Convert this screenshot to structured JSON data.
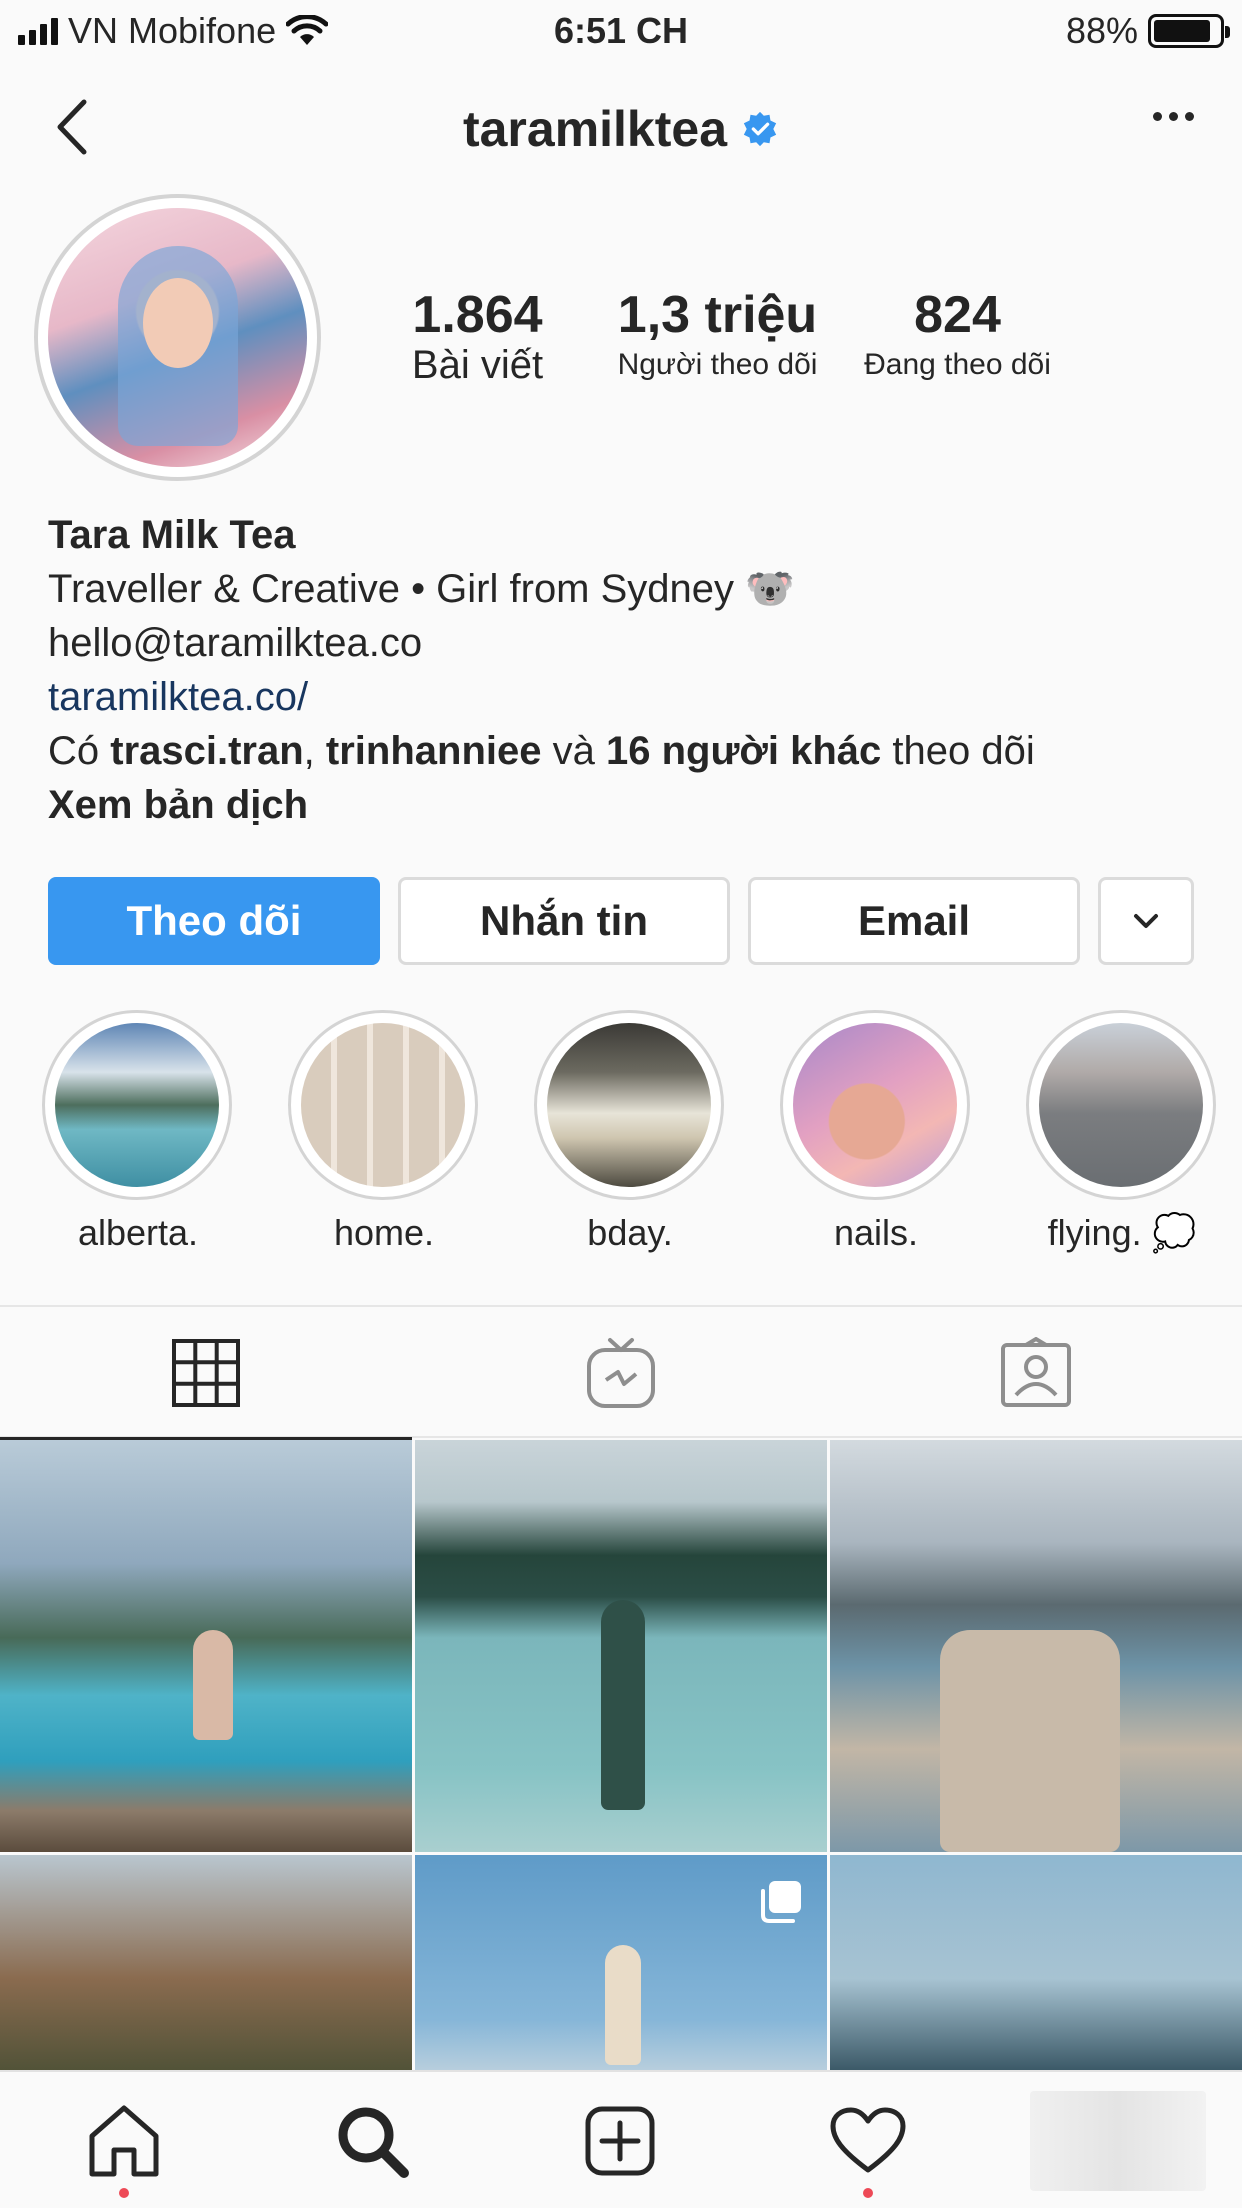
{
  "status_bar": {
    "carrier": "VN Mobifone",
    "time": "6:51 CH",
    "battery": "88%",
    "battery_level": 0.88
  },
  "header": {
    "username": "taramilktea",
    "verified": true,
    "back_icon": "chevron-left-icon",
    "more_icon": "ellipsis-icon"
  },
  "profile": {
    "stats": [
      {
        "value": "1.864",
        "label": "Bài viết"
      },
      {
        "value": "1,3 triệu",
        "label": "Người theo dõi"
      },
      {
        "value": "824",
        "label": "Đang theo dõi"
      }
    ],
    "name": "Tara Milk Tea",
    "bio_line": "Traveller & Creative • Girl from Sydney 🐨",
    "email": "hello@taramilktea.co",
    "website": "taramilktea.co/",
    "followed_by": {
      "prefix": "Có ",
      "user1": "trasci.tran",
      "sep": ", ",
      "user2": "trinhanniee",
      "and": " và ",
      "others": "16 người khác",
      "suffix": " theo dõi"
    },
    "translate": "Xem bản dịch"
  },
  "actions": {
    "follow": "Theo dõi",
    "message": "Nhắn tin",
    "email": "Email",
    "dropdown_icon": "chevron-down-icon"
  },
  "highlights": [
    {
      "label": "alberta."
    },
    {
      "label": "home."
    },
    {
      "label": "bday."
    },
    {
      "label": "nails."
    },
    {
      "label": "flying. 💭"
    }
  ],
  "tabs": [
    {
      "name": "grid-icon",
      "active": true
    },
    {
      "name": "igtv-icon",
      "active": false
    },
    {
      "name": "tagged-icon",
      "active": false
    }
  ],
  "bottom_nav": [
    {
      "name": "home-icon",
      "notification": true
    },
    {
      "name": "search-icon",
      "notification": false
    },
    {
      "name": "add-post-icon",
      "notification": false
    },
    {
      "name": "heart-icon",
      "notification": true
    },
    {
      "name": "profile-avatar",
      "notification": false
    }
  ],
  "colors": {
    "accent": "#3897f0",
    "link": "#18365f",
    "notification": "#ed4956"
  }
}
